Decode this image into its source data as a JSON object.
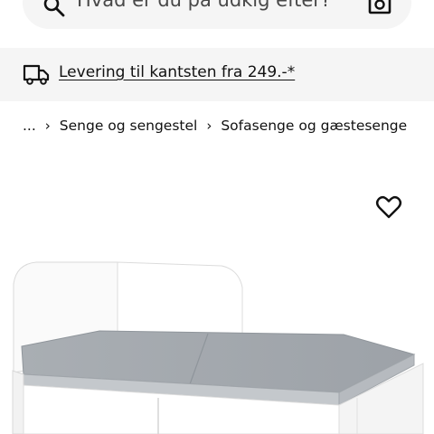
{
  "search": {
    "placeholder": "Hvad er du på udkig efter?",
    "search_icon": "search-icon",
    "camera_icon": "camera-icon"
  },
  "delivery": {
    "icon": "truck-icon",
    "text": "Levering til kantsten fra 249.-*"
  },
  "breadcrumb": {
    "ellipsis": "...",
    "items": [
      "Senge og sengestel",
      "Sofasenge og gæstesenge"
    ]
  },
  "product": {
    "favorite_icon": "heart-icon",
    "image": "daybed-product-image",
    "colors": {
      "frame": "#ffffff",
      "mattress": "#a3a8ad",
      "panel_bg": "#f5f5f5"
    }
  }
}
